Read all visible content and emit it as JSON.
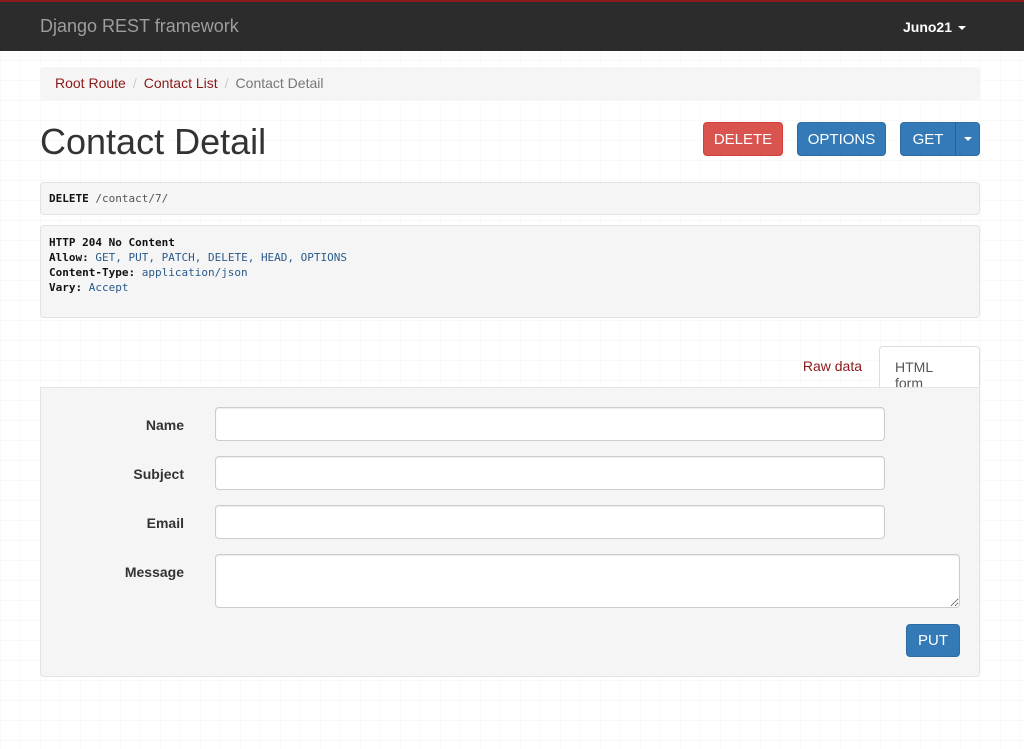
{
  "navbar": {
    "brand": "Django REST framework",
    "user": "Juno21"
  },
  "breadcrumb": {
    "items": [
      "Root Route",
      "Contact List"
    ],
    "active": "Contact Detail",
    "separator": "/"
  },
  "page": {
    "title": "Contact Detail"
  },
  "actions": {
    "delete_label": "DELETE",
    "options_label": "OPTIONS",
    "get_label": "GET"
  },
  "request": {
    "method": "DELETE",
    "path": "/contact/7/"
  },
  "response": {
    "status": "HTTP 204 No Content",
    "headers": [
      {
        "key": "Allow:",
        "value": "GET, PUT, PATCH, DELETE, HEAD, OPTIONS"
      },
      {
        "key": "Content-Type:",
        "value": "application/json"
      },
      {
        "key": "Vary:",
        "value": "Accept"
      }
    ]
  },
  "tabs": {
    "raw": "Raw data",
    "html": "HTML form"
  },
  "form": {
    "fields": [
      {
        "label": "Name",
        "value": ""
      },
      {
        "label": "Subject",
        "value": ""
      },
      {
        "label": "Email",
        "value": ""
      }
    ],
    "message_label": "Message",
    "message_value": "",
    "submit_label": "PUT"
  },
  "colors": {
    "navbar": "#2c2c2c",
    "link": "#8b1a1a",
    "danger": "#d9534f",
    "primary": "#337ab7"
  }
}
